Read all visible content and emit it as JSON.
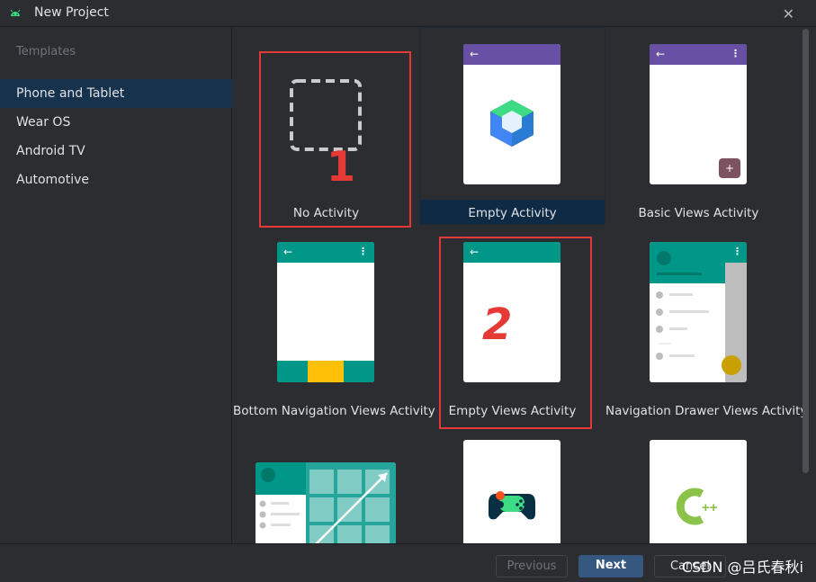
{
  "window": {
    "title": "New Project",
    "close_glyph": "✕"
  },
  "sidebar": {
    "header": "Templates",
    "items": [
      {
        "label": "Phone and Tablet",
        "selected": true
      },
      {
        "label": "Wear OS"
      },
      {
        "label": "Android TV"
      },
      {
        "label": "Automotive"
      }
    ]
  },
  "templates": [
    {
      "label": "No Activity"
    },
    {
      "label": "Empty Activity",
      "selected": true
    },
    {
      "label": "Basic Views Activity"
    },
    {
      "label": "Bottom Navigation Views Activity"
    },
    {
      "label": "Empty Views Activity"
    },
    {
      "label": "Navigation Drawer Views Activity"
    }
  ],
  "annotations": {
    "mark_1": "1",
    "mark_2": "2"
  },
  "footer": {
    "previous_label": "Previous",
    "next_label": "Next",
    "cancel_label": "Cancel",
    "watermark": "CSDN @吕氏春秋i"
  },
  "icons": {
    "back_arrow": "←",
    "menu_dots": "⋮",
    "fab_plus": "+",
    "cpp": "C++"
  },
  "colors": {
    "purple_appbar": "#6750a4",
    "teal_appbar": "#009688",
    "annotation_red": "#e53935",
    "selected_bg": "#16324c",
    "bottom_nav_yellow": "#ffc107"
  }
}
